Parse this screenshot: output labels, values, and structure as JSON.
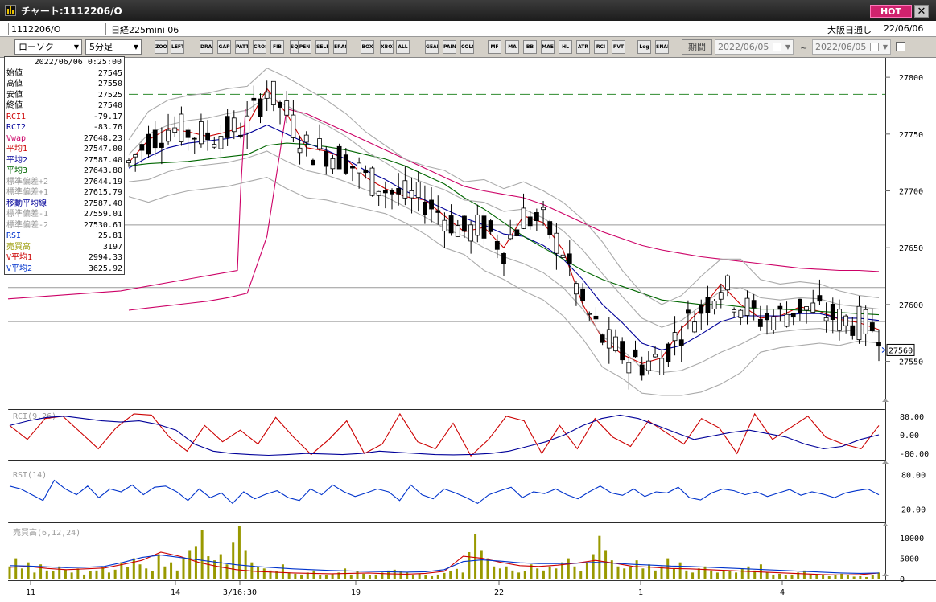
{
  "window": {
    "title": "チャート:1112206/O",
    "hot_label": "HOT",
    "close_glyph": "✕"
  },
  "info": {
    "code": "1112206/O",
    "instrument": "日経225mini 06",
    "market": "大阪日通し",
    "date": "22/06/06"
  },
  "toolbar": {
    "chart_type": "ローソク",
    "interval": "5分足",
    "buttons": [
      "ZOOM",
      "LEFT",
      "DRAW",
      "GAP",
      "PATTERN",
      "CROSS",
      "FIB",
      "SQUARE",
      "PEN",
      "SELECT",
      "ERASE",
      "BOX",
      "XBOX",
      "ALL",
      "GEAR",
      "PAINT",
      "COLOR",
      "MF",
      "MA",
      "BB",
      "MAE",
      "HL",
      "ATR",
      "RCI",
      "PVT",
      "Log",
      "SNAP"
    ],
    "period_label": "期間",
    "date_from": "2022/06/05",
    "date_to": "2022/06/05",
    "tilde": "~"
  },
  "data_window": {
    "datetime": "2022/06/06 0:25:00",
    "rows": [
      {
        "label": "始値",
        "value": "27545",
        "color": "#000000"
      },
      {
        "label": "高値",
        "value": "27550",
        "color": "#000000"
      },
      {
        "label": "安値",
        "value": "27525",
        "color": "#000000"
      },
      {
        "label": "終値",
        "value": "27540",
        "color": "#000000"
      },
      {
        "label": "RCI1",
        "value": "-79.17",
        "color": "#cc0000"
      },
      {
        "label": "RCI2",
        "value": "-83.76",
        "color": "#000099"
      },
      {
        "label": "Vwap",
        "value": "27648.23",
        "color": "#cc0066"
      },
      {
        "label": "平均1",
        "value": "27547.00",
        "color": "#cc0000"
      },
      {
        "label": "平均2",
        "value": "27587.40",
        "color": "#000099"
      },
      {
        "label": "平均3",
        "value": "27643.80",
        "color": "#006600"
      },
      {
        "label": "標準偏差+2",
        "value": "27644.19",
        "color": "#999999"
      },
      {
        "label": "標準偏差+1",
        "value": "27615.79",
        "color": "#999999"
      },
      {
        "label": "移動平均線",
        "value": "27587.40",
        "color": "#000099"
      },
      {
        "label": "標準偏差-1",
        "value": "27559.01",
        "color": "#999999"
      },
      {
        "label": "標準偏差-2",
        "value": "27530.61",
        "color": "#999999"
      },
      {
        "label": "RSI",
        "value": "25.81",
        "color": "#0033cc"
      },
      {
        "label": "売買高",
        "value": "3197",
        "color": "#999900"
      },
      {
        "label": "V平均1",
        "value": "2994.33",
        "color": "#cc0000"
      },
      {
        "label": "V平均2",
        "value": "3625.92",
        "color": "#0033cc"
      }
    ]
  },
  "chart_data": [
    {
      "type": "candlestick",
      "yticks": [
        27550,
        27600,
        27650,
        27700,
        27750,
        27800
      ],
      "ylim": [
        27520,
        27810
      ],
      "xticks": [
        "11",
        "14",
        "3/16:30",
        "19",
        "22",
        "1",
        "4"
      ],
      "last_price": "27560",
      "series": [
        {
          "name": "Vwap",
          "color": "#cc0066",
          "values": [
            27595,
            27597,
            27599,
            27601,
            27603,
            27606,
            27610,
            27660,
            27772,
            27768,
            27760,
            27752,
            27744,
            27736,
            27728,
            27720,
            27712,
            27704,
            27700,
            27697,
            27694,
            27688,
            27680,
            27672,
            27664,
            27658,
            27652,
            27648,
            27645,
            27642,
            27640,
            27638,
            27636,
            27634,
            27632,
            27631,
            27630,
            27630,
            27629
          ]
        },
        {
          "name": "平均1",
          "color": "#cc0000",
          "values": [
            27725,
            27745,
            27755,
            27752,
            27748,
            27752,
            27758,
            27790,
            27768,
            27738,
            27735,
            27728,
            27712,
            27702,
            27695,
            27692,
            27678,
            27664,
            27668,
            27650,
            27678,
            27672,
            27648,
            27600,
            27570,
            27556,
            27548,
            27553,
            27579,
            27596,
            27618,
            27600,
            27588,
            27590,
            27598,
            27594,
            27587,
            27584,
            27578
          ]
        },
        {
          "name": "平均2",
          "color": "#000099",
          "values": [
            27720,
            27730,
            27738,
            27742,
            27744,
            27746,
            27750,
            27758,
            27750,
            27742,
            27736,
            27728,
            27718,
            27710,
            27700,
            27692,
            27684,
            27676,
            27670,
            27662,
            27660,
            27652,
            27640,
            27622,
            27600,
            27584,
            27566,
            27560,
            27564,
            27574,
            27585,
            27590,
            27590,
            27590,
            27592,
            27592,
            27588,
            27588,
            27586
          ]
        },
        {
          "name": "平均3",
          "color": "#006600",
          "values": [
            27722,
            27724,
            27725,
            27726,
            27728,
            27730,
            27732,
            27740,
            27742,
            27741,
            27739,
            27736,
            27732,
            27728,
            27722,
            27714,
            27706,
            27694,
            27684,
            27672,
            27660,
            27650,
            27640,
            27630,
            27622,
            27616,
            27610,
            27604,
            27602,
            27600,
            27600,
            27598,
            27596,
            27596,
            27595,
            27594,
            27593,
            27592,
            27591
          ]
        },
        {
          "name": "標準偏差+2",
          "color": "#aaaaaa",
          "values": [
            27745,
            27770,
            27780,
            27784,
            27786,
            27790,
            27792,
            27808,
            27800,
            27790,
            27780,
            27768,
            27752,
            27740,
            27728,
            27722,
            27718,
            27708,
            27710,
            27702,
            27708,
            27700,
            27690,
            27675,
            27655,
            27630,
            27610,
            27600,
            27608,
            27625,
            27640,
            27640,
            27622,
            27618,
            27620,
            27618,
            27612,
            27608,
            27606
          ]
        },
        {
          "name": "標準偏差-2",
          "color": "#aaaaaa",
          "values": [
            27695,
            27690,
            27696,
            27700,
            27702,
            27704,
            27708,
            27712,
            27702,
            27694,
            27692,
            27688,
            27684,
            27680,
            27672,
            27662,
            27650,
            27644,
            27630,
            27622,
            27612,
            27604,
            27590,
            27570,
            27545,
            27535,
            27522,
            27520,
            27520,
            27523,
            27530,
            27540,
            27558,
            27562,
            27564,
            27566,
            27564,
            27568,
            27566
          ]
        },
        {
          "name": "標準偏差+1",
          "color": "#aaaaaa",
          "values": [
            27732,
            27750,
            27758,
            27762,
            27764,
            27768,
            27771,
            27783,
            27775,
            27766,
            27758,
            27748,
            27735,
            27725,
            27714,
            27707,
            27701,
            27692,
            27690,
            27682,
            27684,
            27676,
            27665,
            27648,
            27627,
            27607,
            27588,
            27580,
            27586,
            27599,
            27612,
            27615,
            27606,
            27604,
            27606,
            27605,
            27600,
            27598,
            27596
          ]
        },
        {
          "name": "標準偏差-1",
          "color": "#aaaaaa",
          "values": [
            27708,
            27710,
            27717,
            27721,
            27723,
            27725,
            27729,
            27735,
            27726,
            27718,
            27714,
            27708,
            27701,
            27695,
            27686,
            27677,
            27667,
            27660,
            27650,
            27642,
            27636,
            27628,
            27615,
            27596,
            27572,
            27560,
            27544,
            27540,
            27542,
            27549,
            27558,
            27565,
            27574,
            27576,
            27578,
            27579,
            27576,
            27578,
            27576
          ]
        }
      ],
      "candles_ohlc_approx": {
        "count": 115,
        "start": 27720,
        "end": 27560
      },
      "horizontal_levels": [
        27785,
        27670,
        27615,
        27585
      ]
    },
    {
      "type": "line",
      "title": "RCI(9,26)",
      "yticks": [
        "80.00",
        "0.00",
        "-80.00"
      ],
      "ylim": [
        -100,
        100
      ],
      "series": [
        {
          "name": "RCI1",
          "color": "#cc0000",
          "values": [
            40,
            -20,
            70,
            80,
            10,
            -60,
            30,
            90,
            85,
            -10,
            -70,
            40,
            -30,
            20,
            -40,
            75,
            -10,
            -85,
            -20,
            60,
            -80,
            -40,
            90,
            -30,
            -60,
            50,
            -90,
            -20,
            80,
            60,
            -80,
            40,
            -60,
            70,
            -10,
            -50,
            60,
            10,
            -40,
            70,
            30,
            -80,
            90,
            -20,
            30,
            80,
            -10,
            -40,
            -60,
            40
          ]
        },
        {
          "name": "RCI2",
          "color": "#000099",
          "values": [
            40,
            60,
            75,
            80,
            70,
            60,
            55,
            60,
            45,
            20,
            -40,
            -70,
            -80,
            -85,
            -88,
            -85,
            -80,
            -82,
            -85,
            -80,
            -70,
            -75,
            -80,
            -85,
            -86,
            -84,
            -80,
            -70,
            -50,
            -30,
            0,
            40,
            70,
            85,
            70,
            40,
            10,
            -20,
            -5,
            10,
            20,
            5,
            -10,
            -40,
            -60,
            -50,
            -20,
            0
          ]
        }
      ]
    },
    {
      "type": "line",
      "title": "RSI(14)",
      "yticks": [
        "80.00",
        "20.00"
      ],
      "ylim": [
        0,
        100
      ],
      "series": [
        {
          "name": "RSI",
          "color": "#0033cc",
          "values": [
            60,
            55,
            45,
            35,
            70,
            55,
            45,
            60,
            40,
            55,
            50,
            62,
            45,
            58,
            60,
            50,
            35,
            55,
            40,
            48,
            30,
            50,
            38,
            46,
            52,
            40,
            35,
            55,
            45,
            62,
            50,
            42,
            48,
            55,
            50,
            35,
            62,
            45,
            38,
            55,
            48,
            40,
            30,
            45,
            52,
            58,
            40,
            50,
            47,
            55,
            45,
            38,
            50,
            60,
            48,
            44,
            55,
            42,
            50,
            48,
            58,
            40,
            36,
            48,
            55,
            52,
            45,
            50,
            42,
            48,
            54,
            44,
            50,
            46,
            40,
            48,
            52,
            55,
            45
          ]
        }
      ]
    },
    {
      "type": "bar",
      "title": "売買高(6,12,24)",
      "yticks": [
        "10000",
        "5000",
        "0"
      ],
      "ylim": [
        0,
        13000
      ],
      "series": [
        {
          "name": "売買高",
          "color": "#999900",
          "values": [
            3000,
            5000,
            2500,
            4000,
            1500,
            3500,
            2000,
            1800,
            3000,
            2200,
            1500,
            2500,
            1000,
            1800,
            2000,
            3000,
            1500,
            2200,
            4000,
            2800,
            5000,
            3500,
            2500,
            1800,
            6000,
            3000,
            4000,
            2000,
            5000,
            7000,
            8000,
            12000,
            5500,
            4500,
            6000,
            3500,
            9000,
            13000,
            7000,
            4000,
            3000,
            2500,
            2000,
            1800,
            3500,
            1500,
            1200,
            1000,
            1500,
            2000,
            800,
            1000,
            1200,
            1500,
            2500,
            1000,
            1800,
            1200,
            800,
            1000,
            1500,
            2000,
            2200,
            1800,
            1500,
            1000,
            1200,
            800,
            600,
            1000,
            1400,
            1800,
            2400,
            1500,
            6500,
            11000,
            7000,
            5000,
            3000,
            2500,
            3000,
            2000,
            1500,
            1800,
            3500,
            2500,
            2000,
            3000,
            2500,
            4000,
            5000,
            3000,
            1800,
            4000,
            6000,
            10500,
            7000,
            4500,
            3000,
            2500,
            3000,
            4500,
            2500,
            3500,
            2000,
            3000,
            5000,
            2500,
            4000,
            2000,
            1500,
            2500,
            3000,
            2000,
            1500,
            2000,
            1800,
            1500,
            2500,
            3000,
            2000,
            3500,
            1500,
            1000,
            1200,
            800,
            1000,
            1500,
            2000,
            1200,
            1000,
            800,
            600,
            1000,
            1200,
            800,
            500,
            600,
            400,
            800,
            1500
          ]
        },
        {
          "name": "V平均1",
          "color": "#cc0000",
          "values": [
            2800,
            3000,
            2500,
            2200,
            2400,
            2600,
            3500,
            4500,
            6500,
            5500,
            4000,
            3000,
            2200,
            1800,
            1600,
            1400,
            1300,
            1200,
            1300,
            1400,
            1200,
            1100,
            1300,
            1800,
            5500,
            5000,
            4000,
            3200,
            3000,
            3300,
            3800,
            4500,
            3800,
            3000,
            2800,
            2500,
            2400,
            2200,
            2000,
            1800,
            1600,
            1400,
            1200,
            1000,
            900,
            1000,
            1400
          ]
        },
        {
          "name": "V平均2",
          "color": "#0033cc",
          "values": [
            3200,
            3100,
            2900,
            2700,
            2800,
            3000,
            4000,
            5200,
            5800,
            5200,
            4600,
            4000,
            3400,
            3000,
            2700,
            2400,
            2200,
            2000,
            1900,
            1800,
            1700,
            1600,
            1700,
            2200,
            4200,
            4600,
            4300,
            3900,
            3700,
            3700,
            3800,
            4000,
            3800,
            3500,
            3300,
            3100,
            3000,
            2800,
            2600,
            2400,
            2200,
            2000,
            1800,
            1600,
            1400,
            1300,
            1400
          ]
        }
      ]
    }
  ]
}
